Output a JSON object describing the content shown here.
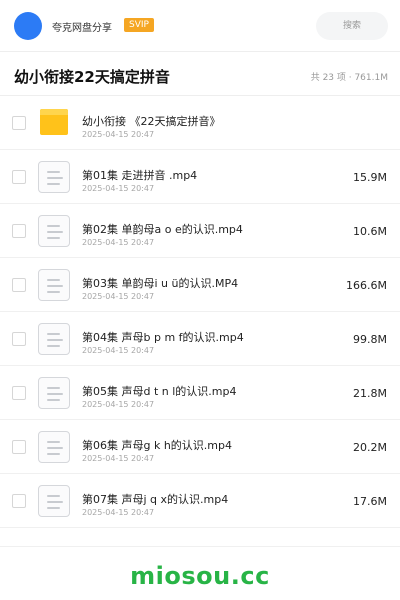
{
  "header": {
    "user_name": "夸克网盘分享",
    "badge": "SVIP",
    "search_placeholder": "搜索"
  },
  "folder": {
    "title": "幼小衔接22天搞定拼音",
    "stats": "共 23 项 · 761.1M"
  },
  "items": [
    {
      "type": "folder",
      "icon": "folder-icon",
      "name": "幼小衔接 《22天搞定拼音》",
      "date": "2025-04-15 20:47",
      "size": ""
    },
    {
      "type": "file",
      "icon": "file-icon",
      "name": "第01集 走进拼音 .mp4",
      "date": "2025-04-15 20:47",
      "size": "15.9M"
    },
    {
      "type": "file",
      "icon": "file-icon",
      "name": "第02集 单韵母a o e的认识.mp4",
      "date": "2025-04-15 20:47",
      "size": "10.6M"
    },
    {
      "type": "file",
      "icon": "file-icon",
      "name": "第03集 单韵母i u ü的认识.MP4",
      "date": "2025-04-15 20:47",
      "size": "166.6M"
    },
    {
      "type": "file",
      "icon": "file-icon",
      "name": "第04集 声母b p m f的认识.mp4",
      "date": "2025-04-15 20:47",
      "size": "99.8M"
    },
    {
      "type": "file",
      "icon": "file-icon",
      "name": "第05集 声母d t n l的认识.mp4",
      "date": "2025-04-15 20:47",
      "size": "21.8M"
    },
    {
      "type": "file",
      "icon": "file-icon",
      "name": "第06集 声母g k h的认识.mp4",
      "date": "2025-04-15 20:47",
      "size": "20.2M"
    },
    {
      "type": "file",
      "icon": "file-icon",
      "name": "第07集 声母j q x的认识.mp4",
      "date": "2025-04-15 20:47",
      "size": "17.6M"
    }
  ],
  "footer": {
    "watermark": "miosou.cc"
  },
  "colors": {
    "avatar": "#2c7bf5",
    "svip_badge": "#f5a623",
    "folder": "#ffc21a",
    "watermark": "#28b446"
  }
}
